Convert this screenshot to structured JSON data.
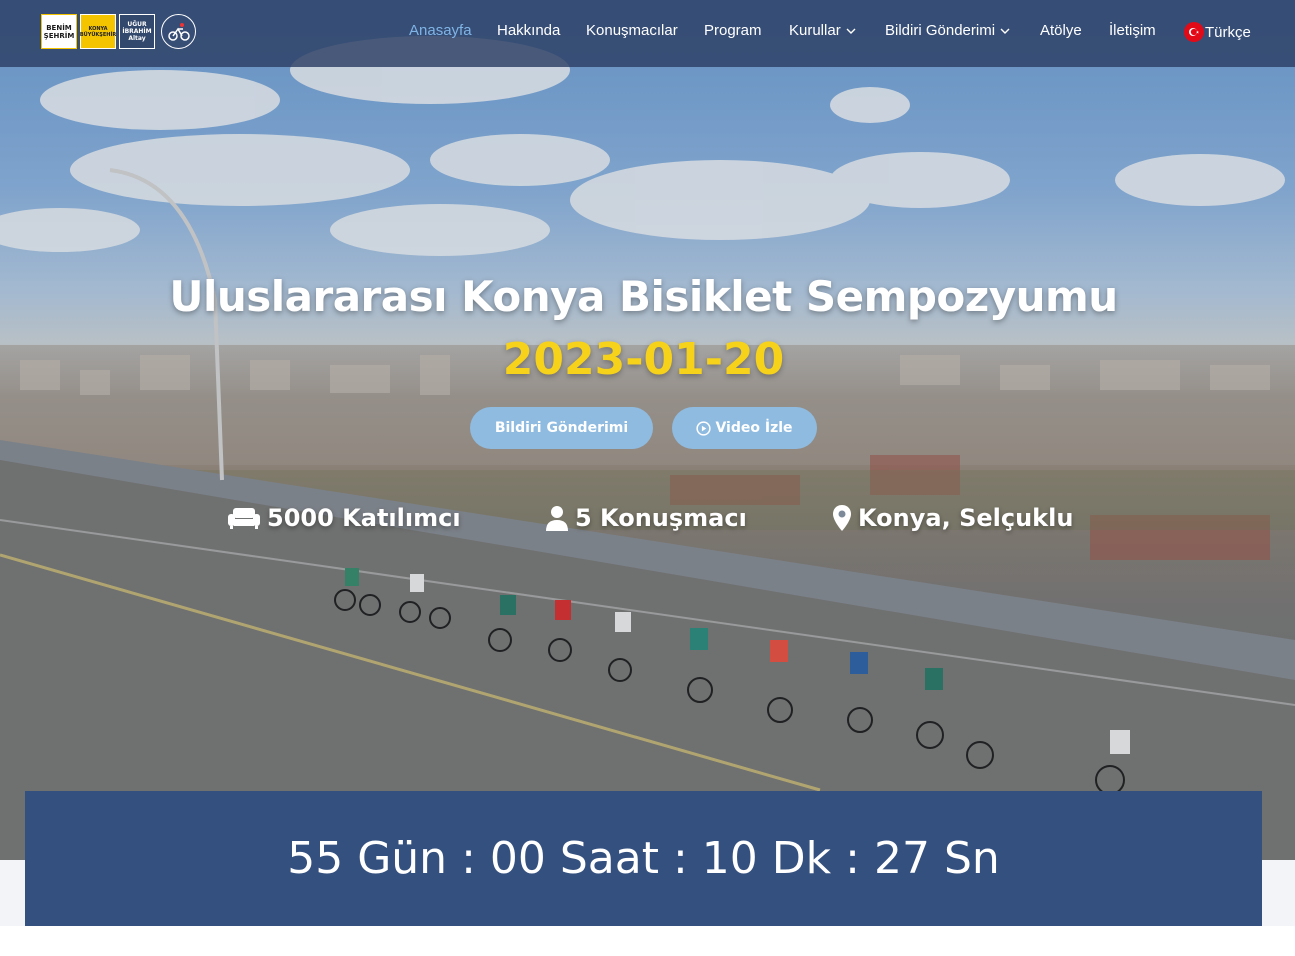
{
  "brand": {
    "logo1_text": "BENİM ŞEHRİM",
    "logo2_text": "KONYA BÜYÜKŞEHİR",
    "logo3_text": "UĞUR İBRAHİM Altay"
  },
  "nav": {
    "items": [
      {
        "label": "Anasayfa",
        "active": true
      },
      {
        "label": "Hakkında"
      },
      {
        "label": "Konuşmacılar"
      },
      {
        "label": "Program"
      },
      {
        "label": "Kurullar",
        "dropdown": true
      },
      {
        "label": "Bildiri Gönderimi",
        "dropdown": true
      },
      {
        "label": "Atölye"
      },
      {
        "label": "İletişim"
      }
    ],
    "language": "Türkçe"
  },
  "hero": {
    "title": "Uluslararası Konya Bisiklet Sempozyumu",
    "date": "2023-01-20",
    "buttons": {
      "submit": "Bildiri Gönderimi",
      "video": "Video İzle"
    },
    "stats": [
      {
        "icon": "couch-icon",
        "text": "5000 Katılımcı"
      },
      {
        "icon": "user-icon",
        "text": "5 Konuşmacı"
      },
      {
        "icon": "map-marker-icon",
        "text": "Konya, Selçuklu"
      }
    ]
  },
  "countdown": {
    "days": "55",
    "days_label": "Gün",
    "hours": "00",
    "hours_label": "Saat",
    "minutes": "10",
    "minutes_label": "Dk",
    "seconds": "27",
    "seconds_label": "Sn"
  },
  "colors": {
    "nav_bg": "#2c3e64",
    "active_link": "#7fb4e6",
    "date": "#f7d21a",
    "button": "#8fbbe0",
    "countdown_bg": "#34507f"
  }
}
